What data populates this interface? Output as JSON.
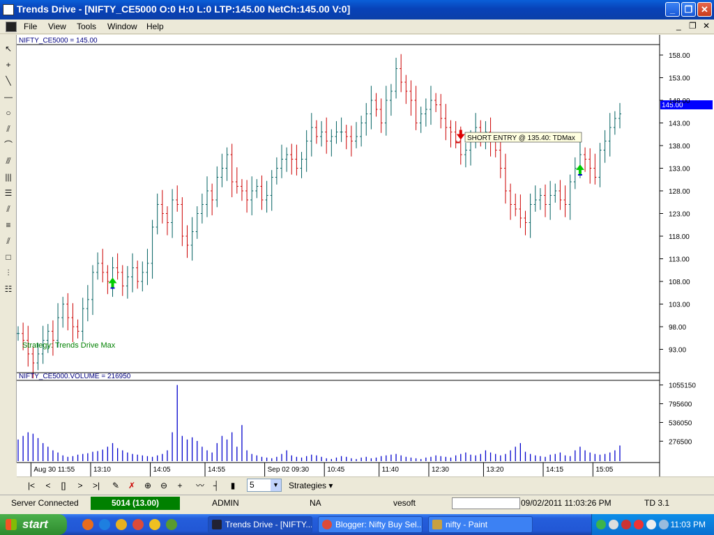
{
  "window": {
    "title": "Trends Drive - [NIFTY_CE5000 O:0 H:0 L:0 LTP:145.00 NetCh:145.00 V:0]"
  },
  "menu": {
    "items": [
      "File",
      "View",
      "Tools",
      "Window",
      "Help"
    ]
  },
  "chart": {
    "price_label": "NIFTY_CE5000 = 145.00",
    "volume_label": "NIFTY_CE5000.VOLUME = 216950",
    "strategy_text": "Strategy: Trends Drive Max",
    "short_entry_text": "SHORT ENTRY @ 135.40: TDMax",
    "last_price_tag": "145.00",
    "price_ticks": [
      "158.00",
      "153.00",
      "148.00",
      "143.00",
      "138.00",
      "133.00",
      "128.00",
      "123.00",
      "118.00",
      "113.00",
      "108.00",
      "103.00",
      "98.00",
      "93.00"
    ],
    "volume_ticks": [
      "1055150",
      "795600",
      "536050",
      "276500"
    ],
    "time_ticks": [
      "Aug 30 11:55",
      "13:10",
      "14:05",
      "14:55",
      "Sep 02 09:30",
      "10:45",
      "11:40",
      "12:30",
      "13:20",
      "14:15",
      "15:05"
    ],
    "colors": {
      "up": "#006060",
      "down": "#cc0000",
      "volume": "#0000cc",
      "label": "#000080",
      "last_price_bg": "#0000ff",
      "up_arrow": "#00cc00",
      "down_arrow": "#dd0000",
      "strategy": "#008000"
    }
  },
  "chart_data": {
    "type": "ohlc",
    "ylim": [
      88,
      160
    ],
    "price_series": [
      96.5,
      95,
      92,
      90,
      92,
      95,
      97,
      95,
      100,
      103,
      100,
      98,
      97,
      102,
      104,
      110,
      112,
      110,
      108,
      111,
      110,
      107,
      109,
      111,
      108,
      110,
      112,
      120,
      125,
      123,
      121,
      126,
      125,
      118,
      116,
      119,
      123,
      125,
      128,
      126,
      131,
      133,
      136,
      130,
      129,
      128,
      126,
      128,
      129,
      126,
      127,
      131,
      133,
      135,
      136,
      135,
      133,
      135,
      139,
      142,
      140,
      141,
      139,
      140,
      141,
      141,
      140,
      139,
      140,
      143,
      145,
      148,
      146,
      143,
      148,
      150,
      155,
      152,
      150,
      148,
      143,
      145,
      146,
      148,
      147,
      144,
      142,
      141,
      139,
      136,
      137,
      139,
      142,
      140,
      141,
      139,
      137,
      133,
      128,
      125,
      124,
      122,
      121,
      125,
      126,
      127,
      125,
      127,
      128,
      126,
      125,
      130,
      133,
      136,
      135,
      133,
      131,
      137,
      139,
      142,
      144,
      145
    ],
    "up_signal_prices": [
      107,
      132
    ],
    "down_signal_price": 139,
    "volume_max": 1100000,
    "volume_values": [
      300000,
      350000,
      400000,
      380000,
      320000,
      250000,
      200000,
      150000,
      120000,
      80000,
      60000,
      70000,
      90000,
      100000,
      110000,
      130000,
      140000,
      160000,
      200000,
      250000,
      180000,
      150000,
      120000,
      100000,
      90000,
      80000,
      70000,
      60000,
      80000,
      100000,
      150000,
      400000,
      1055150,
      350000,
      300000,
      330000,
      280000,
      200000,
      150000,
      120000,
      250000,
      350000,
      300000,
      400000,
      200000,
      500000,
      150000,
      100000,
      80000,
      60000,
      50000,
      40000,
      60000,
      100000,
      150000,
      80000,
      60000,
      50000,
      70000,
      90000,
      80000,
      60000,
      40000,
      30000,
      50000,
      70000,
      60000,
      40000,
      30000,
      50000,
      60000,
      40000,
      50000,
      70000,
      80000,
      90000,
      100000,
      80000,
      60000,
      50000,
      40000,
      30000,
      50000,
      60000,
      80000,
      70000,
      60000,
      50000,
      80000,
      100000,
      120000,
      90000,
      80000,
      100000,
      150000,
      120000,
      100000,
      80000,
      100000,
      150000,
      200000,
      250000,
      130000,
      100000,
      80000,
      70000,
      60000,
      90000,
      100000,
      120000,
      80000,
      70000,
      150000,
      200000,
      150000,
      120000,
      100000,
      90000,
      100000,
      120000,
      150000,
      216950
    ]
  },
  "toolbar": {
    "period_value": "5",
    "strategies_label": "Strategies"
  },
  "status": {
    "connection": "Server Connected",
    "count": "5014 (13.00)",
    "user": "ADMIN",
    "na": "NA",
    "vendor": "vesoft",
    "datetime": "09/02/2011 11:03:26 PM",
    "version": "TD 3.1"
  },
  "taskbar": {
    "start_label": "start",
    "tasks": [
      "Trends Drive - [NIFTY...",
      "Blogger: Nifty Buy Sel...",
      "nifty - Paint"
    ],
    "clock": "11:03 PM"
  }
}
